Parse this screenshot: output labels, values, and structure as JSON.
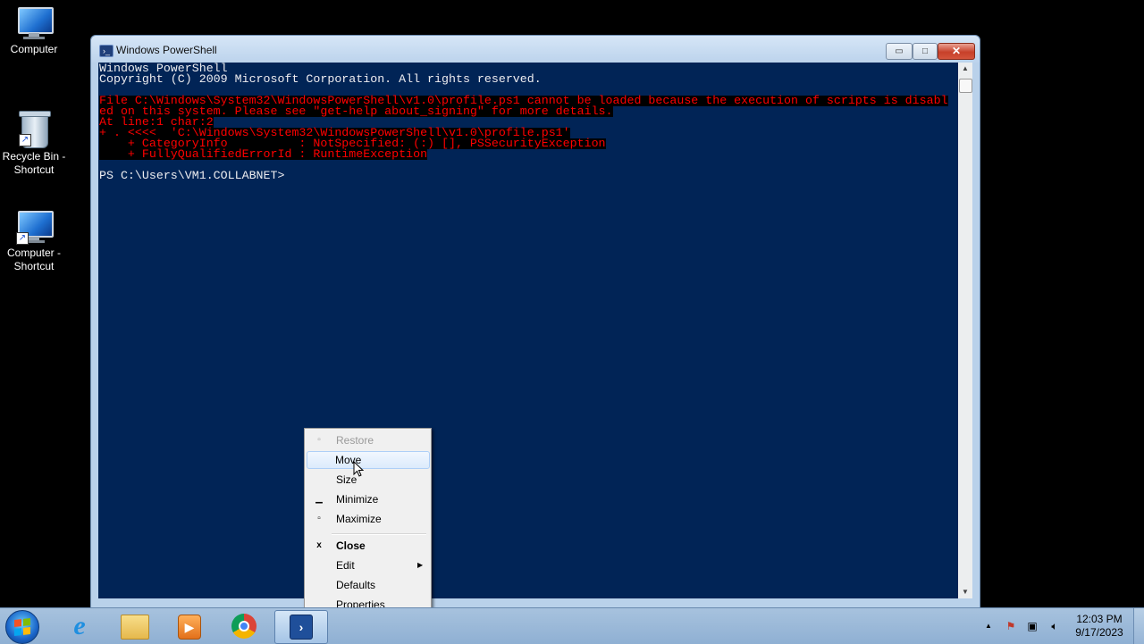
{
  "desktop": {
    "icons": [
      {
        "label": "Computer"
      },
      {
        "label": "Recycle Bin - Shortcut"
      },
      {
        "label": "Computer - Shortcut"
      }
    ]
  },
  "window": {
    "title": "Windows PowerShell",
    "caption_buttons": {
      "minimize": "▭",
      "maximize": "□",
      "close": "✕"
    }
  },
  "console": {
    "lines": [
      {
        "text": "Windows PowerShell",
        "type": "normal"
      },
      {
        "text": "Copyright (C) 2009 Microsoft Corporation. All rights reserved.",
        "type": "normal"
      },
      {
        "text": "",
        "type": "normal"
      },
      {
        "text": "File C:\\Windows\\System32\\WindowsPowerShell\\v1.0\\profile.ps1 cannot be loaded because the execution of scripts is disabl",
        "type": "error"
      },
      {
        "text": "ed on this system. Please see \"get-help about_signing\" for more details.",
        "type": "error"
      },
      {
        "text": "At line:1 char:2",
        "type": "error"
      },
      {
        "text": "+ . <<<<  'C:\\Windows\\System32\\WindowsPowerShell\\v1.0\\profile.ps1'",
        "type": "error"
      },
      {
        "text": "    + CategoryInfo          : NotSpecified: (:) [], PSSecurityException",
        "type": "error"
      },
      {
        "text": "    + FullyQualifiedErrorId : RuntimeException",
        "type": "error"
      },
      {
        "text": "",
        "type": "normal"
      },
      {
        "text": "PS C:\\Users\\VM1.COLLABNET>",
        "type": "normal"
      }
    ]
  },
  "context_menu": {
    "items": [
      {
        "label": "Restore",
        "icon": "restore-icon",
        "glyph": "▫",
        "disabled": true
      },
      {
        "label": "Move",
        "icon": "",
        "glyph": "",
        "highlighted": true
      },
      {
        "label": "Size",
        "icon": "",
        "glyph": ""
      },
      {
        "label": "Minimize",
        "icon": "minimize-icon",
        "glyph": "▁"
      },
      {
        "label": "Maximize",
        "icon": "maximize-icon",
        "glyph": "▫"
      },
      {
        "label": "Close",
        "icon": "close-icon",
        "glyph": "x",
        "bold": true
      },
      {
        "label": "Edit",
        "icon": "",
        "glyph": "",
        "submenu": true
      },
      {
        "label": "Defaults",
        "icon": "",
        "glyph": ""
      },
      {
        "label": "Properties",
        "icon": "",
        "glyph": ""
      }
    ]
  },
  "taskbar": {
    "pinned": [
      "start-button",
      "internet-explorer",
      "windows-explorer",
      "windows-media-player",
      "google-chrome",
      "windows-powershell"
    ],
    "clock": {
      "time": "12:03 PM",
      "date": "9/17/2023"
    },
    "tray_icons": [
      "show-hidden-icons",
      "action-center-flag-icon",
      "network-icon",
      "volume-muted-icon"
    ]
  },
  "colors": {
    "console_bg": "#012456",
    "console_fg": "#eeedf0",
    "error_fg": "#ff0000",
    "error_bg": "#000000"
  }
}
